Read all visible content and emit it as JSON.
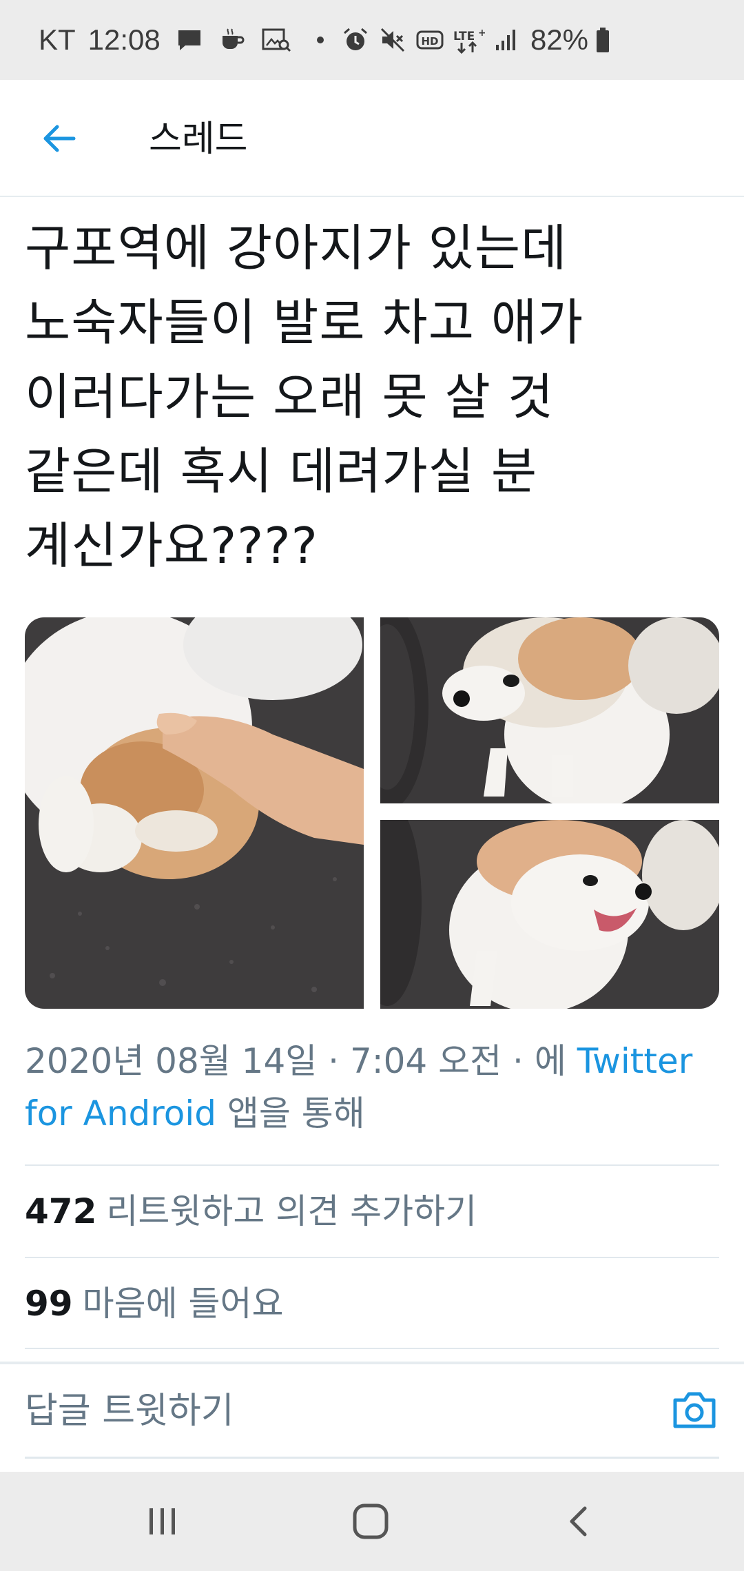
{
  "status_bar": {
    "carrier": "KT",
    "time": "12:08",
    "battery": "82%",
    "left_icons": [
      "chat-bubble-icon",
      "coffee-icon",
      "image-search-icon",
      "dot-icon"
    ],
    "right_icons": [
      "alarm-icon",
      "mute-icon",
      "hd-icon",
      "lte-plus-icon",
      "signal-icon",
      "battery-icon"
    ]
  },
  "header": {
    "title": "스레드",
    "back_icon": "arrow-left-icon",
    "accent_color": "#1b95e0"
  },
  "tweet": {
    "text": "구포역에 강아지가 있는데\n노숙자들이 발로 차고 애가\n이러다가는 오래 못 살 것\n같은데 혹시 데려가실 분\n계신가요????",
    "photos": [
      {
        "name": "photo-dog-being-petted"
      },
      {
        "name": "photo-dog-looking-left"
      },
      {
        "name": "photo-dog-mouth-open"
      }
    ],
    "meta_prefix": "2020년 08월 14일 · 7:04 오전 · 에 ",
    "meta_link": "Twitter for Android",
    "meta_suffix": " 앱을 통해"
  },
  "stats": {
    "retweets_count": "472",
    "retweets_label": "리트윗하고 의견 추가하기",
    "likes_count": "99",
    "likes_label": "마음에 들어요"
  },
  "reply": {
    "placeholder": "답글 트윗하기",
    "camera_icon": "camera-icon"
  },
  "nav_bar": {
    "buttons": [
      "recent-apps-icon",
      "home-icon",
      "back-icon"
    ]
  }
}
